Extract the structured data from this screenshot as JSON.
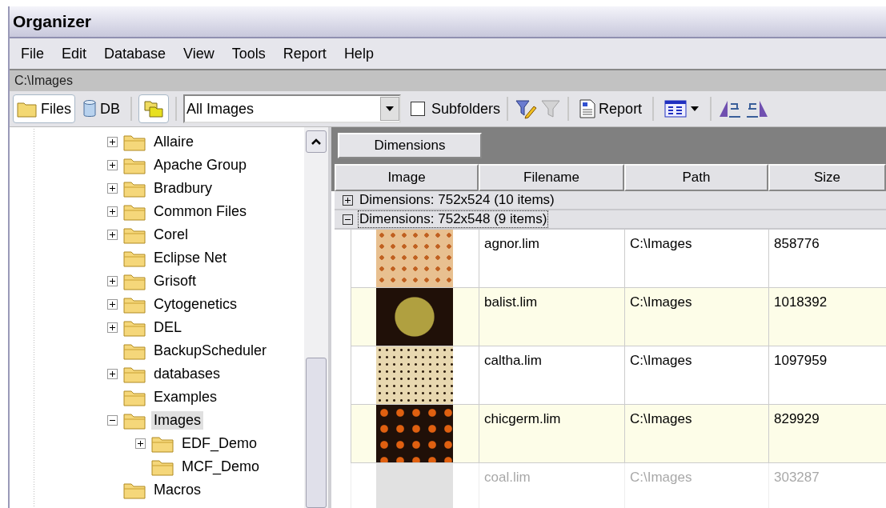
{
  "window": {
    "title": "Organizer"
  },
  "menu": [
    "File",
    "Edit",
    "Database",
    "View",
    "Tools",
    "Report",
    "Help"
  ],
  "path_bar": "C:\\Images",
  "toolbar": {
    "files": {
      "label": "Files",
      "selected": true
    },
    "db": {
      "label": "DB",
      "selected": false
    },
    "filter": {
      "value": "All Images"
    },
    "subfolders": {
      "label": "Subfolders",
      "checked": false
    },
    "clear_filter": {
      "disabled": true
    },
    "report": {
      "label": "Report"
    }
  },
  "tree": [
    {
      "kind": "branch",
      "label": "Allaire",
      "expanded": false,
      "selected": false
    },
    {
      "kind": "branch",
      "label": "Apache Group",
      "expanded": false,
      "selected": false
    },
    {
      "kind": "branch",
      "label": "Bradbury",
      "expanded": false,
      "selected": false
    },
    {
      "kind": "branch",
      "label": "Common Files",
      "expanded": false,
      "selected": false
    },
    {
      "kind": "branch",
      "label": "Corel",
      "expanded": false,
      "selected": false
    },
    {
      "kind": "leaf",
      "label": "Eclipse Net",
      "selected": false
    },
    {
      "kind": "branch",
      "label": "Grisoft",
      "expanded": false,
      "selected": false
    },
    {
      "kind": "branch",
      "label": "Cytogenetics",
      "expanded": false,
      "selected": false
    },
    {
      "kind": "branch",
      "label": "DEL",
      "expanded": false,
      "selected": false
    },
    {
      "kind": "leaf",
      "label": "BackupScheduler",
      "selected": false
    },
    {
      "kind": "branch",
      "label": "databases",
      "expanded": false,
      "selected": false
    },
    {
      "kind": "leaf",
      "label": "Examples",
      "selected": false
    },
    {
      "kind": "branch",
      "label": "Images",
      "expanded": true,
      "selected": true,
      "children": [
        {
          "kind": "branch",
          "label": "EDF_Demo",
          "expanded": false,
          "selected": false
        },
        {
          "kind": "leaf",
          "label": "MCF_Demo",
          "selected": false
        }
      ]
    },
    {
      "kind": "leaf",
      "label": "Macros",
      "selected": false
    }
  ],
  "group_by": [
    "Dimensions"
  ],
  "table": {
    "columns": [
      "Image",
      "Filename",
      "Path",
      "Size"
    ],
    "groups": [
      {
        "label": "Dimensions: 752x524 (10 items)",
        "expanded": false,
        "selected": false
      },
      {
        "label": "Dimensions: 752x548 (9 items)",
        "expanded": true,
        "selected": true,
        "rows": [
          {
            "filename": "agnor.lim",
            "path": "C:\\Images",
            "size": "858776"
          },
          {
            "filename": "balist.lim",
            "path": "C:\\Images",
            "size": "1018392"
          },
          {
            "filename": "caltha.lim",
            "path": "C:\\Images",
            "size": "1097959"
          },
          {
            "filename": "chicgerm.lim",
            "path": "C:\\Images",
            "size": "829929"
          },
          {
            "filename": "coal.lim",
            "path": "C:\\Images",
            "size": "303287"
          }
        ]
      }
    ]
  }
}
